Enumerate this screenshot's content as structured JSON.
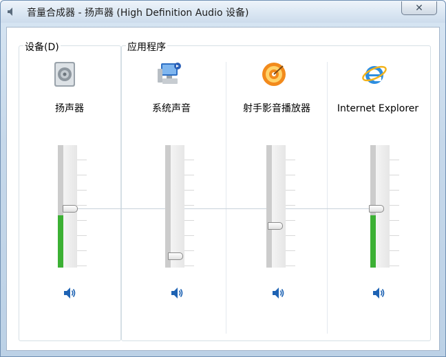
{
  "window": {
    "title": "音量合成器 - 扬声器 (High Definition Audio 设备)",
    "close_label": "✕"
  },
  "device_group": {
    "label": "设备(D)",
    "device_name": "扬声器",
    "volume_percent": 50,
    "meter_level_percent": 43,
    "muted": false
  },
  "apps_group": {
    "label": "应用程序",
    "apps": [
      {
        "name": "系统声音",
        "volume_percent": 6,
        "meter_level_percent": 0,
        "muted": false
      },
      {
        "name": "射手影音播放器",
        "volume_percent": 38,
        "meter_level_percent": 0,
        "muted": false
      },
      {
        "name": "Internet Explorer",
        "volume_percent": 50,
        "meter_level_percent": 43,
        "muted": false
      }
    ]
  },
  "colors": {
    "meter_active": "#3cb034",
    "meter_idle": "#cccccc",
    "speaker_icon": "#1e63b4"
  }
}
